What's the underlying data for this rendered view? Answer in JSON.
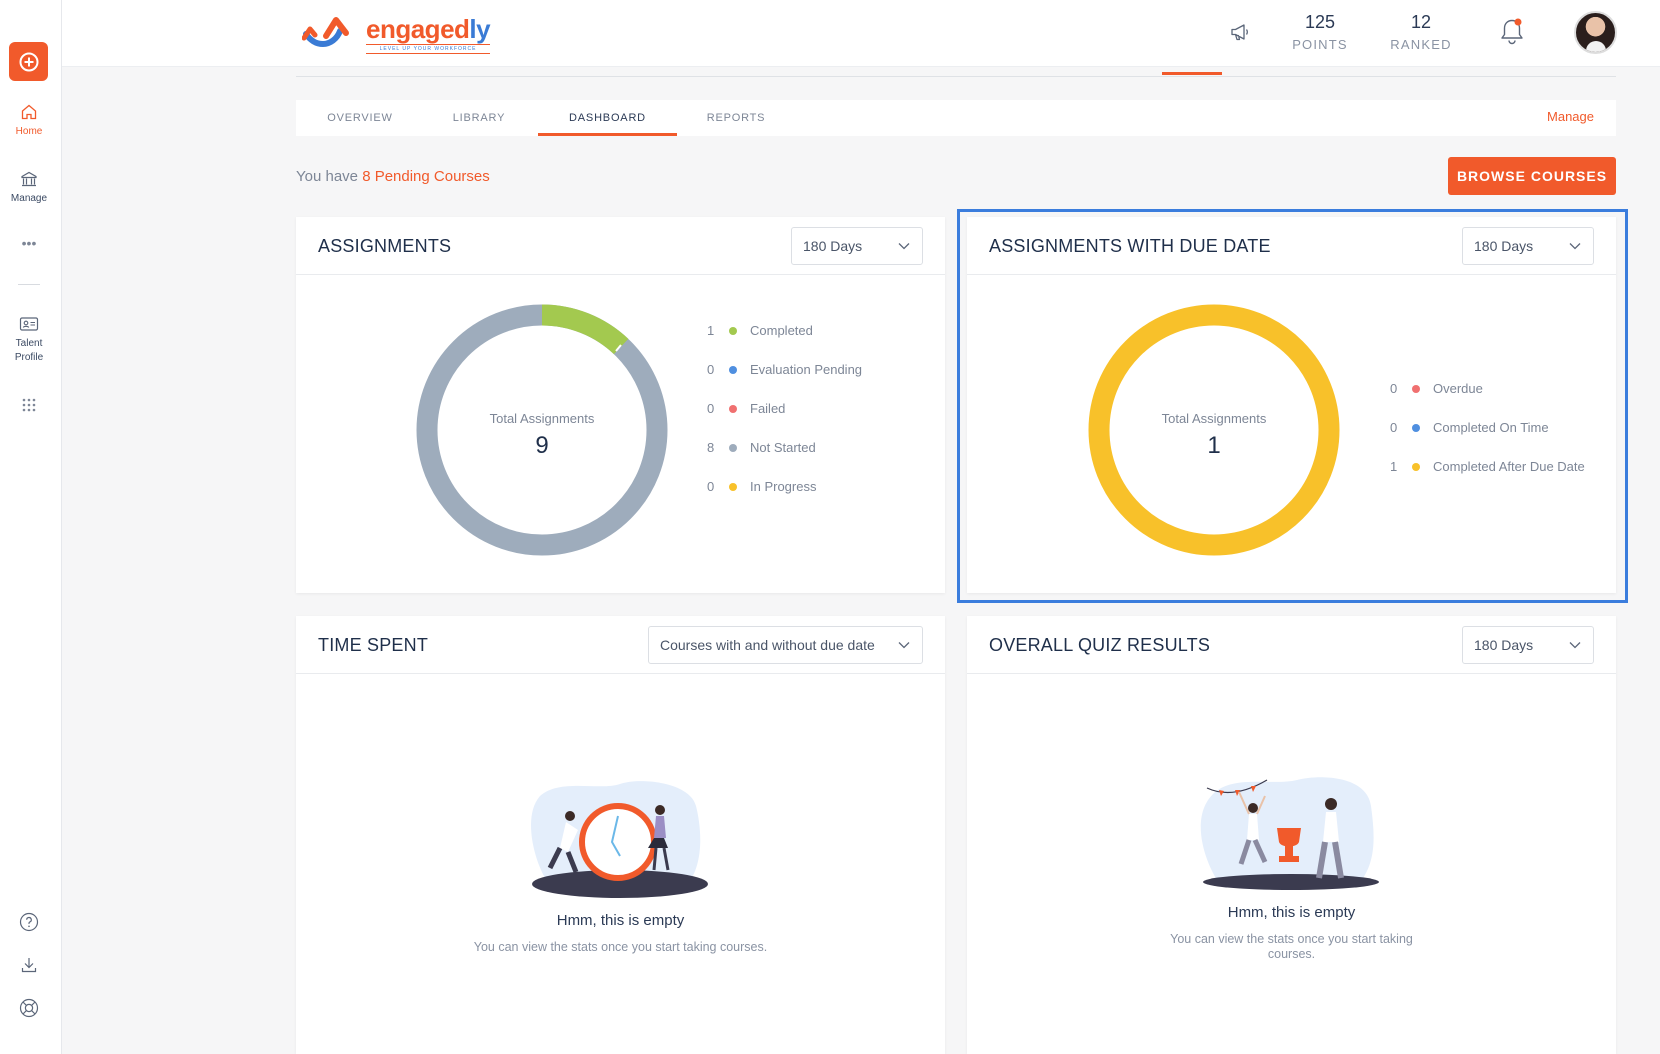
{
  "sidebar": {
    "items": [
      {
        "label": "Home",
        "icon": "home-icon"
      },
      {
        "label": "Manage",
        "icon": "bank-icon"
      },
      {
        "label": "Talent Profile",
        "line1": "Talent",
        "line2": "Profile",
        "icon": "id-card-icon"
      }
    ]
  },
  "header": {
    "logo": {
      "text_main": "engaged",
      "text_accent": "ly",
      "tagline": "LEVEL UP YOUR WORKFORCE"
    },
    "points": {
      "value": "125",
      "label": "POINTS"
    },
    "ranked": {
      "value": "12",
      "label": "RANKED"
    }
  },
  "tabs": [
    {
      "label": "OVERVIEW"
    },
    {
      "label": "LIBRARY"
    },
    {
      "label": "DASHBOARD"
    },
    {
      "label": "REPORTS"
    }
  ],
  "manage_link": "Manage",
  "pending": {
    "prefix": "You have ",
    "highlight": "8 Pending Courses"
  },
  "browse_button": "BROWSE COURSES",
  "assignments": {
    "title": "ASSIGNMENTS",
    "range": "180 Days",
    "center_label": "Total Assignments",
    "total": "9",
    "legend": [
      {
        "count": "1",
        "label": "Completed",
        "color": "#a3c94f"
      },
      {
        "count": "0",
        "label": "Evaluation Pending",
        "color": "#4f8fe0"
      },
      {
        "count": "0",
        "label": "Failed",
        "color": "#f07070"
      },
      {
        "count": "8",
        "label": "Not Started",
        "color": "#9eacbc"
      },
      {
        "count": "0",
        "label": "In Progress",
        "color": "#f8c12a"
      }
    ]
  },
  "due_date": {
    "title": "ASSIGNMENTS WITH DUE DATE",
    "range": "180 Days",
    "center_label": "Total Assignments",
    "total": "1",
    "legend": [
      {
        "count": "0",
        "label": "Overdue",
        "color": "#f07070"
      },
      {
        "count": "0",
        "label": "Completed On Time",
        "color": "#4f8fe0"
      },
      {
        "count": "1",
        "label": "Completed After Due Date",
        "color": "#f8c12a"
      }
    ]
  },
  "time_spent": {
    "title": "TIME SPENT",
    "filter": "Courses with and without due date",
    "empty_title": "Hmm, this is empty",
    "empty_sub": "You can view the stats once you start taking courses."
  },
  "quiz": {
    "title": "OVERALL QUIZ RESULTS",
    "range": "180 Days",
    "empty_title": "Hmm, this is empty",
    "empty_sub_1": "You can view the stats once you start taking",
    "empty_sub_2": "courses."
  },
  "colors": {
    "accent": "#f15a2b",
    "highlight": "#3b7ddd"
  }
}
